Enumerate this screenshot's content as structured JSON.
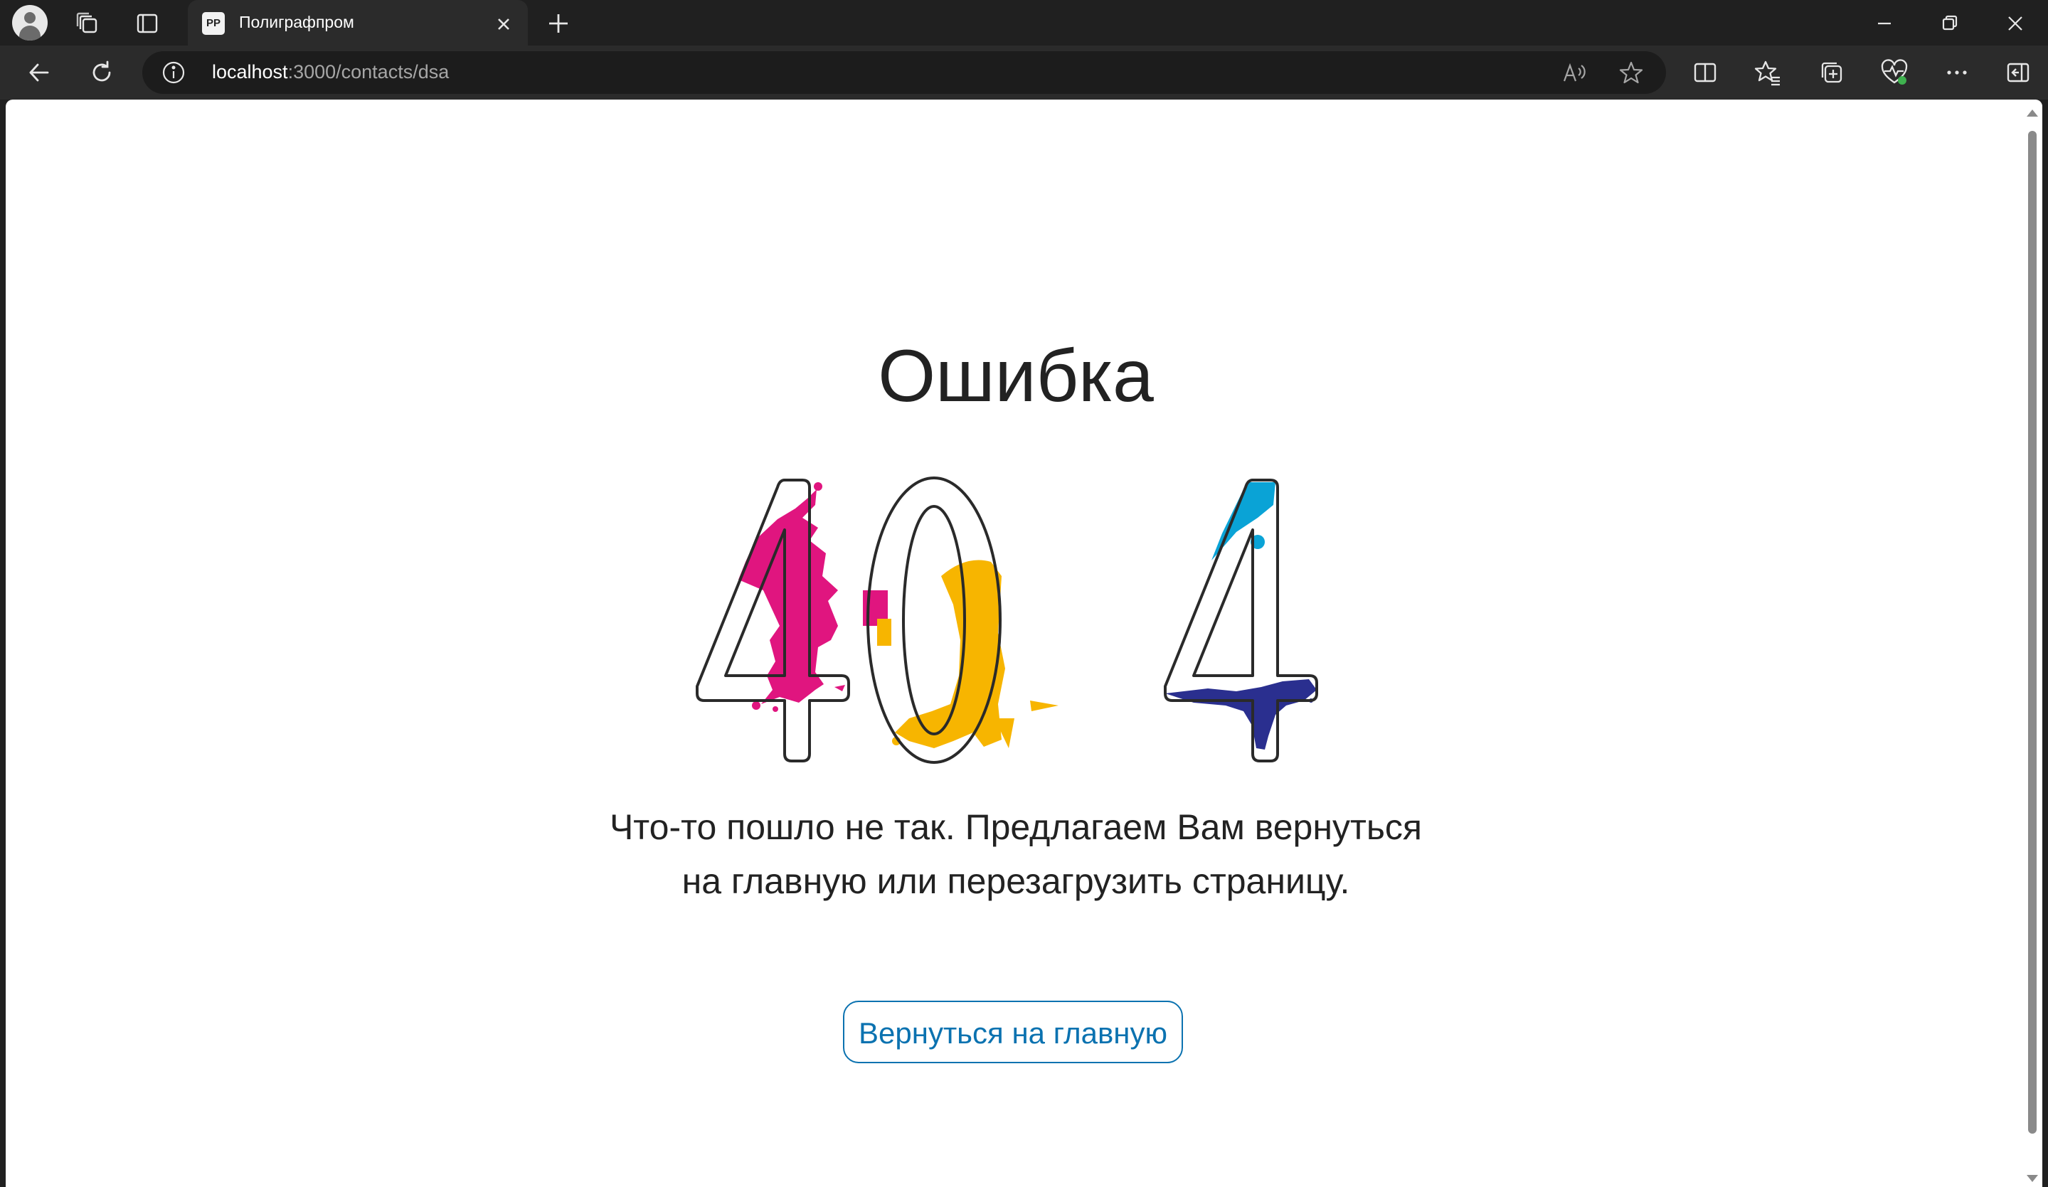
{
  "browser": {
    "tab": {
      "favicon_text": "PP",
      "title": "Полиграфпром"
    },
    "address": {
      "host": "localhost",
      "path": ":3000/contacts/dsa"
    }
  },
  "page": {
    "heading": "Ошибка",
    "error_code": "404",
    "message_line1": "Что-то пошло не так. Предлагаем Вам вернуться",
    "message_line2": "на главную или перезагрузить страницу.",
    "button_label": "Вернуться на главную"
  },
  "colors": {
    "magenta": "#e0157f",
    "yellow": "#f7b500",
    "cyan": "#0aa3d6",
    "navy": "#2a2f8f",
    "button_accent": "#0b72b0"
  }
}
